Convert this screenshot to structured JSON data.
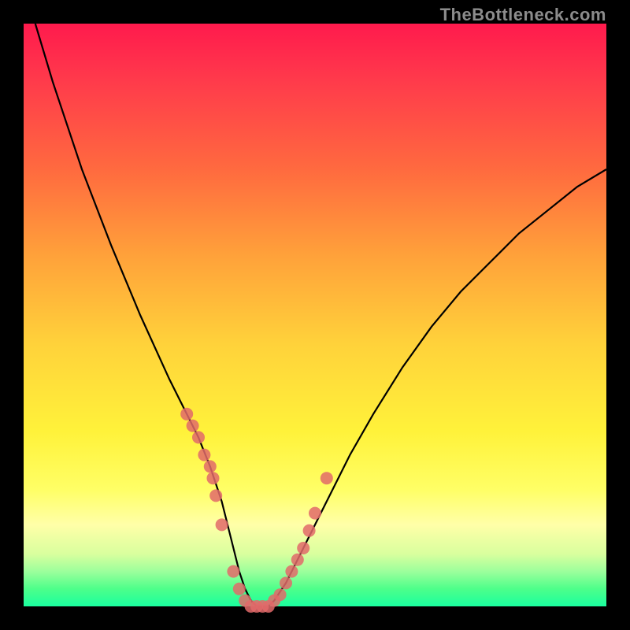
{
  "watermark": "TheBottleneck.com",
  "chart_data": {
    "type": "line",
    "title": "",
    "xlabel": "",
    "ylabel": "",
    "xlim": [
      0,
      100
    ],
    "ylim": [
      0,
      100
    ],
    "grid": false,
    "legend": false,
    "series": [
      {
        "name": "bottleneck-curve",
        "type": "line",
        "color": "#000000",
        "x": [
          2,
          5,
          10,
          15,
          20,
          25,
          28,
          30,
          32,
          34,
          35,
          36,
          37,
          38,
          39,
          40,
          41,
          42,
          43,
          45,
          48,
          52,
          56,
          60,
          65,
          70,
          75,
          80,
          85,
          90,
          95,
          100
        ],
        "y": [
          100,
          90,
          75,
          62,
          50,
          39,
          33,
          29,
          24,
          18,
          14,
          10,
          6,
          3,
          1,
          0,
          0,
          0,
          1,
          4,
          10,
          18,
          26,
          33,
          41,
          48,
          54,
          59,
          64,
          68,
          72,
          75
        ]
      },
      {
        "name": "sample-points",
        "type": "scatter",
        "color": "#e26a6a",
        "x": [
          28,
          29,
          30,
          31,
          32,
          32.5,
          33,
          34,
          36,
          37,
          38,
          39,
          40,
          41,
          42,
          43,
          44,
          45,
          46,
          47,
          48,
          49,
          50,
          52
        ],
        "y": [
          33,
          31,
          29,
          26,
          24,
          22,
          19,
          14,
          6,
          3,
          1,
          0,
          0,
          0,
          0,
          1,
          2,
          4,
          6,
          8,
          10,
          13,
          16,
          22
        ]
      }
    ],
    "background_gradient": {
      "top_color": "#ff1a4d",
      "mid_color": "#fff23a",
      "bottom_color": "#1aff9f"
    }
  }
}
